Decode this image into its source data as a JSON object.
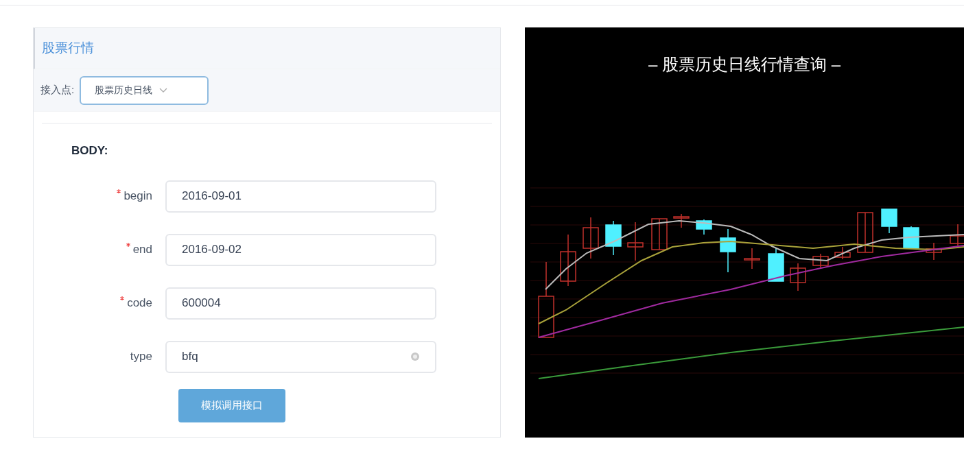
{
  "panel": {
    "title": "股票行情",
    "endpoint": {
      "label": "接入点:",
      "value": "股票历史日线"
    }
  },
  "body": {
    "heading": "BODY:",
    "fields": [
      {
        "label": "begin",
        "required": true,
        "value": "2016-09-01",
        "clearable": false
      },
      {
        "label": "end",
        "required": true,
        "value": "2016-09-02",
        "clearable": false
      },
      {
        "label": "code",
        "required": true,
        "value": "600004",
        "clearable": false
      },
      {
        "label": "type",
        "required": false,
        "value": "bfq",
        "clearable": true
      }
    ],
    "button": "模拟调用接口"
  },
  "preview": {
    "title": "– 股票历史日线行情查询 –"
  }
}
